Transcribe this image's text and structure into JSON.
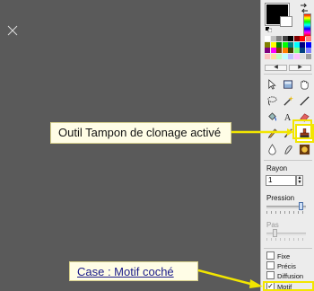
{
  "callouts": {
    "tool": "Outil Tampon de clonage activé",
    "case": "Case : Motif coché"
  },
  "colors": {
    "primary": "#000000",
    "secondary": "#ffffff",
    "accent_highlight": "#f2e600",
    "palette": [
      "#ffffff",
      "#c0c0c0",
      "#808080",
      "#404040",
      "#000000",
      "#800000",
      "#ff0000",
      "#ff8080",
      "#808000",
      "#ffff00",
      "#008000",
      "#00ff00",
      "#008080",
      "#00ffff",
      "#000080",
      "#0000ff",
      "#800080",
      "#ff00ff",
      "#804000",
      "#ff8000",
      "#404000",
      "#80ff80",
      "#004080",
      "#8080ff",
      "#ffc0c0",
      "#ffe0a0",
      "#c0ffc0",
      "#c0ffff",
      "#c0c0ff",
      "#ffc0ff",
      "#e0e0e0",
      "#a0a0a0"
    ]
  },
  "tools": [
    {
      "name": "select-arrow-icon"
    },
    {
      "name": "rect-select-icon"
    },
    {
      "name": "hand-icon"
    },
    {
      "name": "lasso-icon"
    },
    {
      "name": "magic-wand-icon"
    },
    {
      "name": "line-icon"
    },
    {
      "name": "fill-bucket-icon"
    },
    {
      "name": "text-icon"
    },
    {
      "name": "eraser-icon"
    },
    {
      "name": "pencil-icon"
    },
    {
      "name": "brush-icon"
    },
    {
      "name": "clone-stamp-icon",
      "active": true
    },
    {
      "name": "drop-icon"
    },
    {
      "name": "smudge-icon"
    },
    {
      "name": "recolor-icon"
    }
  ],
  "properties": {
    "rayon_label": "Rayon",
    "rayon_value": "1",
    "pression_label": "Pression",
    "pression_level": 0.92,
    "pas_label": "Pas",
    "pas_level": 0.18,
    "checkboxes": [
      {
        "label": "Fixe",
        "checked": false
      },
      {
        "label": "Précis",
        "checked": false
      },
      {
        "label": "Diffusion",
        "checked": false
      },
      {
        "label": "Motif",
        "checked": true
      }
    ]
  }
}
